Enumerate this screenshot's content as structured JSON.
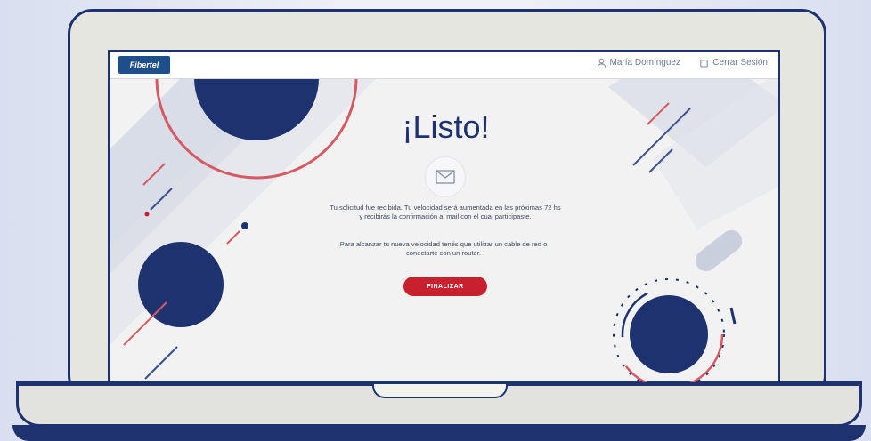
{
  "colors": {
    "navy": "#1f3270",
    "red": "#c8202f",
    "screen_bg": "#f2f2f2",
    "brand": "#1f4f8a"
  },
  "header": {
    "logo_text": "Fibertel",
    "user_name": "María Domínguez",
    "user_icon": "user-icon",
    "logout_label": "Cerrar Sesión",
    "logout_icon": "logout-icon"
  },
  "main": {
    "title": "¡Listo!",
    "mail_icon": "mail-icon",
    "message_1": "Tu solicitud fue recibida. Tu velocidad será aumentada en las próximas 72 hs y recibirás la confirmación al mail con el cual participaste.",
    "message_2": "Para alcanzar tu nueva velocidad tenés que utilizar un cable de red o conectarte con un router.",
    "finish_button": "FINALIZAR"
  }
}
